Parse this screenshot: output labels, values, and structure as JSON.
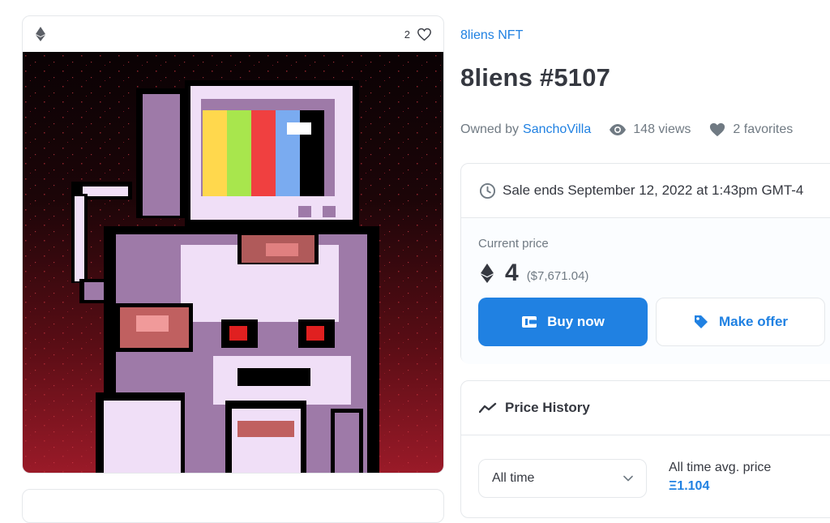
{
  "asset": {
    "favorites_count": "2"
  },
  "collection": {
    "name": "8liens NFT"
  },
  "title": "8liens #5107",
  "meta": {
    "owned_by_label": "Owned by",
    "owner": "SanchoVilla",
    "views": "148 views",
    "favorites": "2 favorites"
  },
  "sale": {
    "ends_text": "Sale ends September 12, 2022 at 1:43pm GMT-4"
  },
  "price": {
    "label": "Current price",
    "amount": "4",
    "usd": "($7,671.04)"
  },
  "actions": {
    "buy_label": "Buy now",
    "offer_label": "Make offer"
  },
  "history": {
    "title": "Price History",
    "range_selected": "All time",
    "avg_label": "All time avg. price",
    "avg_value": "Ξ1.104"
  },
  "colors": {
    "accent": "#2081e2",
    "text": "#353840",
    "muted": "#707a83",
    "border": "#e5e8eb"
  },
  "icons": [
    "ethereum-icon",
    "heart-icon",
    "eye-icon",
    "clock-icon",
    "wallet-icon",
    "tag-icon",
    "trend-icon",
    "chevron-down-icon"
  ]
}
